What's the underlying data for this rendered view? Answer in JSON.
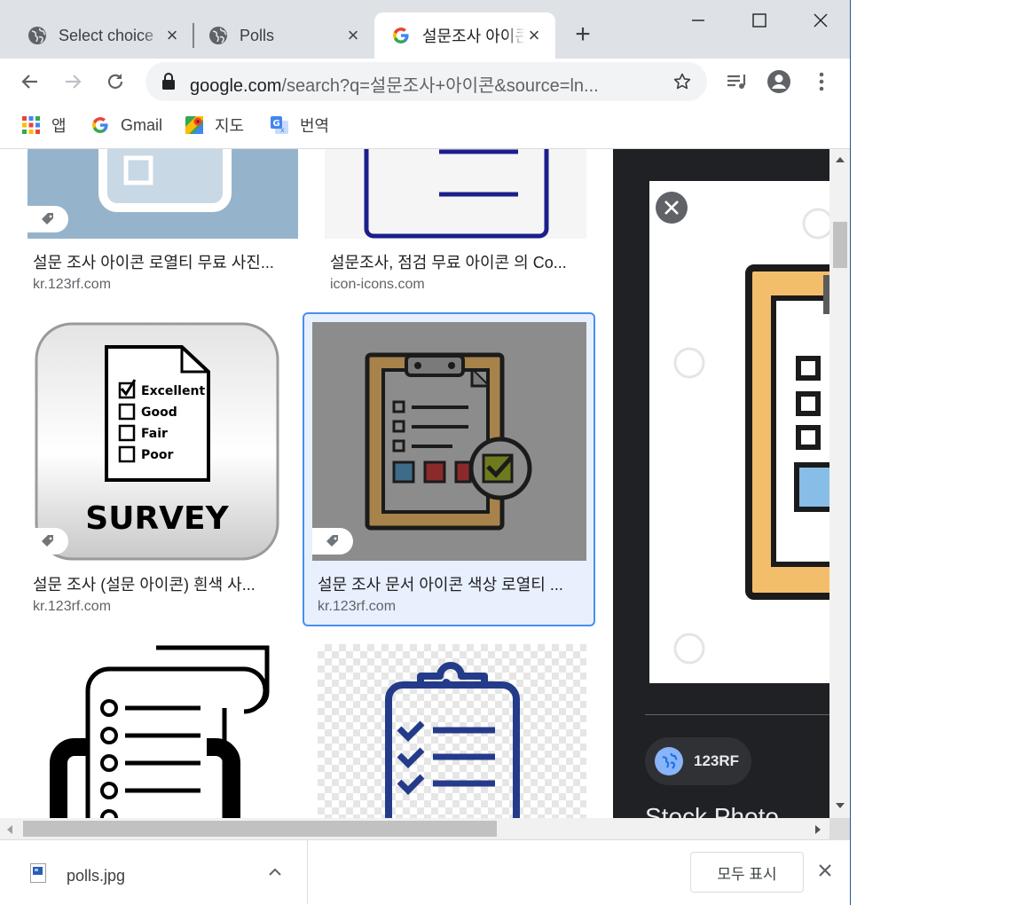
{
  "tabs": [
    {
      "title": "Select choice",
      "favicon": "globe-icon",
      "active": false
    },
    {
      "title": "Polls",
      "favicon": "globe-icon",
      "active": false
    },
    {
      "title": "설문조사 아이콘",
      "favicon": "google-icon",
      "active": true
    }
  ],
  "url": {
    "host": "google.com",
    "path": "/search?q=설문조사+아이콘&source=ln..."
  },
  "bookmarks": [
    {
      "label": "앱",
      "icon": "apps-grid-icon"
    },
    {
      "label": "Gmail",
      "icon": "google-icon"
    },
    {
      "label": "지도",
      "icon": "maps-icon"
    },
    {
      "label": "번역",
      "icon": "translate-icon"
    }
  ],
  "results": [
    {
      "title": "설문 조사 아이콘 로열티 무료 사진...",
      "source": "kr.123rf.com"
    },
    {
      "title": "설문조사, 점검 무료 아이콘 의 Co...",
      "source": "icon-icons.com"
    },
    {
      "title": "설문 조사 (설문 아이콘) 흰색 사...",
      "source": "kr.123rf.com"
    },
    {
      "title": "설문 조사 문서 아이콘 색상 로열티 ...",
      "source": "kr.123rf.com"
    }
  ],
  "survey_image_text": {
    "options": [
      "Excellent",
      "Good",
      "Fair",
      "Poor"
    ],
    "heading": "SURVEY"
  },
  "panel": {
    "source_chip": "123RF",
    "title_partial": "Stock Photo"
  },
  "download": {
    "filename": "polls.jpg",
    "show_all": "모두 표시"
  },
  "colors": {
    "accent": "#4a8ef0",
    "tabstrip": "#dee1e6",
    "panel_bg": "#202124",
    "selected_bg": "#e8f0fe"
  }
}
